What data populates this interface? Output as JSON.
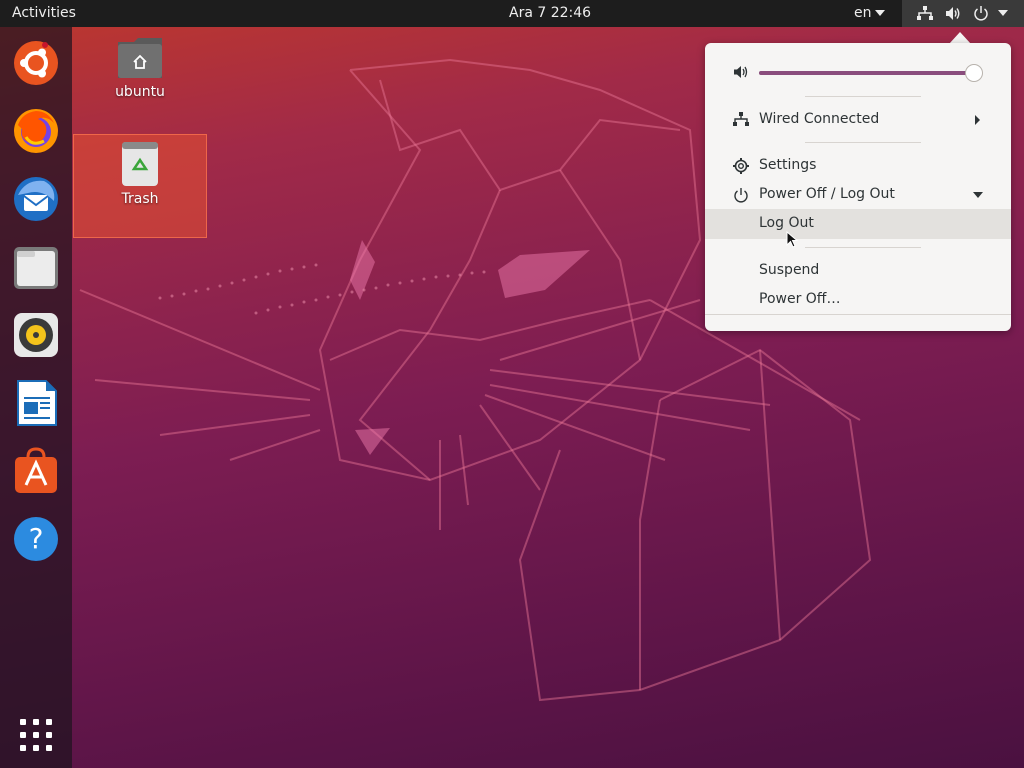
{
  "topbar": {
    "activities": "Activities",
    "clock": "Ara 7  22:46",
    "language": "en"
  },
  "tray_icons": [
    "network-wired-icon",
    "volume-icon",
    "power-icon",
    "chevron-down-icon"
  ],
  "dock": {
    "items": [
      {
        "name": "ubuntu-software-center-icon"
      },
      {
        "name": "firefox-icon"
      },
      {
        "name": "thunderbird-icon"
      },
      {
        "name": "files-icon"
      },
      {
        "name": "rhythmbox-icon"
      },
      {
        "name": "libreoffice-writer-icon"
      },
      {
        "name": "ubuntu-software-icon"
      },
      {
        "name": "help-icon"
      }
    ],
    "show_apps_icon": "app-grid-icon"
  },
  "desktop": {
    "home_label": "ubuntu",
    "trash_label": "Trash"
  },
  "menu": {
    "volume_level": 0.97,
    "wired": "Wired Connected",
    "settings": "Settings",
    "power_header": "Power Off / Log Out",
    "logout": "Log Out",
    "suspend": "Suspend",
    "power_off": "Power Off…"
  },
  "colors": {
    "topbar": "#1d1d1d",
    "menu_bg": "#f6f5f4",
    "slider_fill": "#8a4d7d",
    "hover_row": "#e3e1de"
  }
}
